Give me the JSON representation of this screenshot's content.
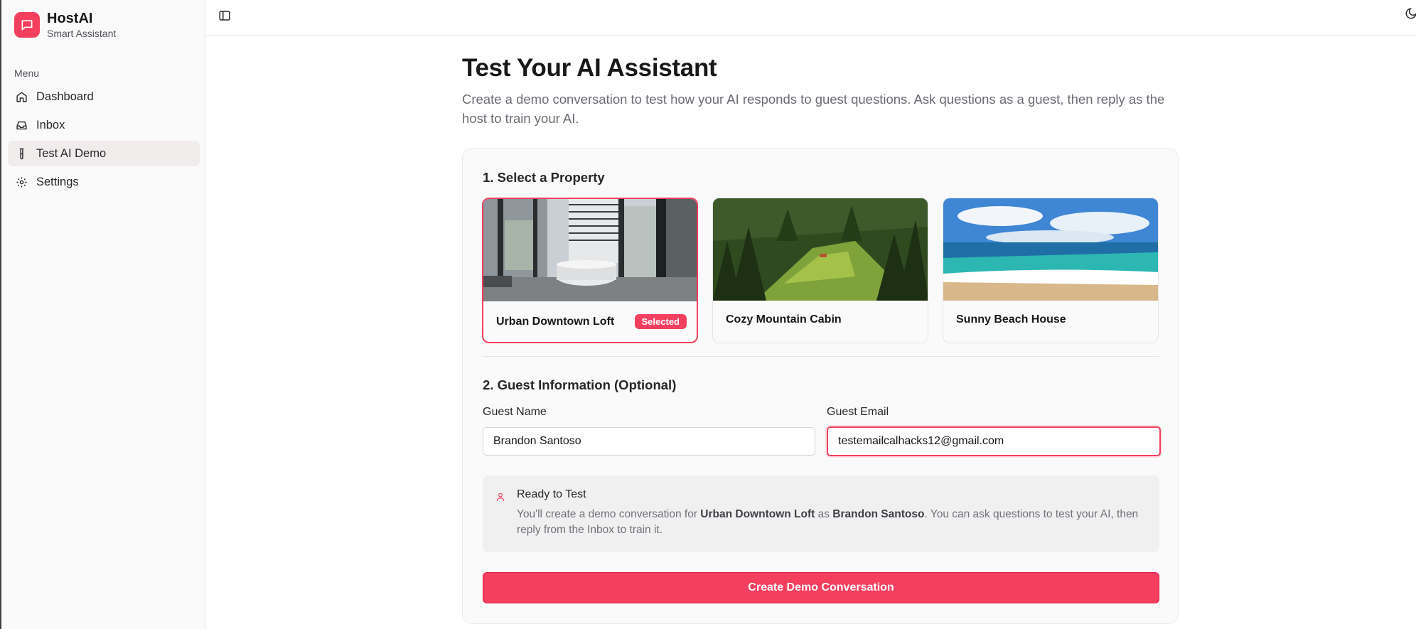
{
  "app": {
    "name": "HostAI",
    "subtitle": "Smart Assistant"
  },
  "sidebar": {
    "menu_label": "Menu",
    "items": [
      {
        "label": "Dashboard",
        "icon": "home-icon"
      },
      {
        "label": "Inbox",
        "icon": "inbox-icon"
      },
      {
        "label": "Test AI Demo",
        "icon": "test-tube-icon",
        "active": true
      },
      {
        "label": "Settings",
        "icon": "gear-icon"
      }
    ]
  },
  "page": {
    "title": "Test Your AI Assistant",
    "description": "Create a demo conversation to test how your AI responds to guest questions. Ask questions as a guest, then reply as the host to train your AI."
  },
  "property_section": {
    "title": "1. Select a Property",
    "selected_badge": "Selected",
    "properties": [
      {
        "name": "Urban Downtown Loft",
        "selected": true
      },
      {
        "name": "Cozy Mountain Cabin",
        "selected": false
      },
      {
        "name": "Sunny Beach House",
        "selected": false
      }
    ]
  },
  "guest_section": {
    "title": "2. Guest Information (Optional)",
    "name_label": "Guest Name",
    "name_value": "Brandon Santoso",
    "email_label": "Guest Email",
    "email_value": "testemailcalhacks12@gmail.com"
  },
  "ready": {
    "title": "Ready to Test",
    "text_prefix": "You'll create a demo conversation for ",
    "property": "Urban Downtown Loft",
    "text_middle": " as ",
    "guest": "Brandon Santoso",
    "text_suffix": ". You can ask questions to test your AI, then reply from the Inbox to train it."
  },
  "create_button": "Create Demo Conversation",
  "colors": {
    "accent": "#f43f5e",
    "sidebar_bg": "#fafafa",
    "active_item_bg": "#f1ecec"
  }
}
